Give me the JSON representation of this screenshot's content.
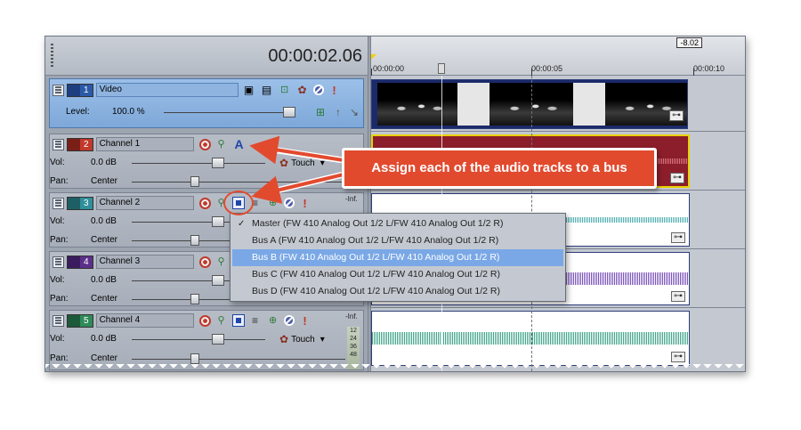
{
  "header": {
    "time": "00:00:02.06",
    "cursor_value": "-8.02",
    "ruler_labels": [
      "00:00:00",
      "00:00:05",
      "00:00:10"
    ]
  },
  "tracks": [
    {
      "type": "video",
      "number": "1",
      "name": "Video",
      "level_label": "Level:",
      "level_value": "100.0 %",
      "color": "#2b5aa8"
    },
    {
      "type": "audio",
      "number": "2",
      "name": "Channel 1",
      "vol_label": "Vol:",
      "vol_value": "0.0 dB",
      "pan_label": "Pan:",
      "pan_value": "Center",
      "automation": "Touch",
      "meter_top": "-Inf.",
      "color": "#c0392b",
      "clip_color": "#8b1e2a",
      "wave_color": "#e27b86"
    },
    {
      "type": "audio",
      "number": "3",
      "name": "Channel 2",
      "vol_label": "Vol:",
      "vol_value": "0.0 dB",
      "pan_label": "Pan:",
      "pan_value": "Center",
      "meter_top": "-Inf.",
      "color": "#2f8f9a",
      "clip_color": "#ffffff",
      "wave_color": "#3aa4a8"
    },
    {
      "type": "audio",
      "number": "4",
      "name": "Channel 3",
      "vol_label": "Vol:",
      "vol_value": "0.0 dB",
      "pan_label": "Pan:",
      "pan_value": "Center",
      "color": "#5a2f8a",
      "clip_color": "#ffffff",
      "wave_color": "#6a3cb0"
    },
    {
      "type": "audio",
      "number": "5",
      "name": "Channel 4",
      "vol_label": "Vol:",
      "vol_value": "0.0 dB",
      "pan_label": "Pan:",
      "pan_value": "Center",
      "automation": "Touch",
      "meter_top": "-Inf.",
      "meter_ticks": [
        "12",
        "24",
        "36",
        "48"
      ],
      "color": "#2f8a5a",
      "clip_color": "#ffffff",
      "wave_color": "#2a9a7a"
    }
  ],
  "bus_menu": {
    "items": [
      "Master (FW 410 Analog Out 1/2 L/FW 410 Analog Out 1/2 R)",
      "Bus A (FW 410 Analog Out 1/2 L/FW 410 Analog Out 1/2 R)",
      "Bus B (FW 410 Analog Out 1/2 L/FW 410 Analog Out 1/2 R)",
      "Bus C (FW 410 Analog Out 1/2 L/FW 410 Analog Out 1/2 R)",
      "Bus D (FW 410 Analog Out 1/2 L/FW 410 Analog Out 1/2 R)"
    ],
    "selected_index": 2
  },
  "callout": {
    "text": "Assign each of the audio tracks to a bus",
    "color": "#e24a2e"
  },
  "icons": {
    "solo": "!",
    "gear": "✿",
    "fx": "⊕"
  }
}
